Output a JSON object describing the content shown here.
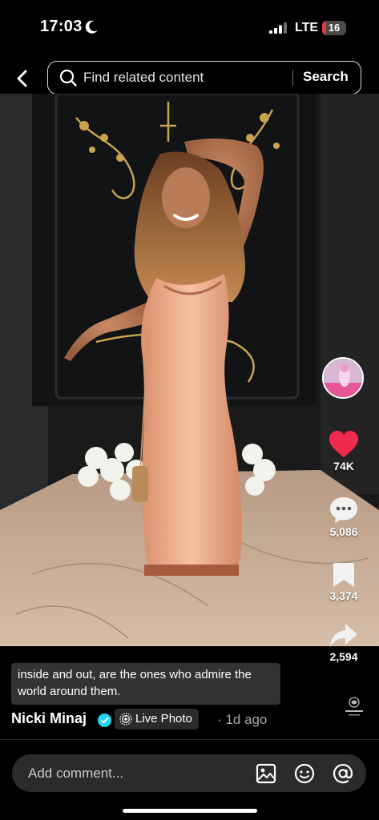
{
  "status_bar": {
    "time": "17:03",
    "network": "LTE",
    "battery": "16",
    "battery_level_percent": 16,
    "battery_color": "#e0393e"
  },
  "search": {
    "placeholder": "Find related content",
    "button_label": "Search"
  },
  "post": {
    "caption": "inside and out, are the ones who admire the world around them.",
    "author": "Nicki Minaj",
    "badge": "Live Photo",
    "time_ago": "· 1d ago"
  },
  "actions": {
    "likes": "74K",
    "comments": "5,086",
    "saves": "3,374",
    "shares": "2,594",
    "like_color": "#f02a4c"
  },
  "comment": {
    "placeholder": "Add comment..."
  },
  "icons": {
    "back": "chevron-left-icon",
    "search": "search-icon",
    "like": "heart-icon",
    "comment": "comment-bubble-icon",
    "save": "bookmark-icon",
    "share": "share-arrow-icon",
    "image": "image-icon",
    "emoji": "emoji-icon",
    "mention": "at-icon",
    "live_photo": "live-photo-icon",
    "verified": "verified-icon"
  }
}
